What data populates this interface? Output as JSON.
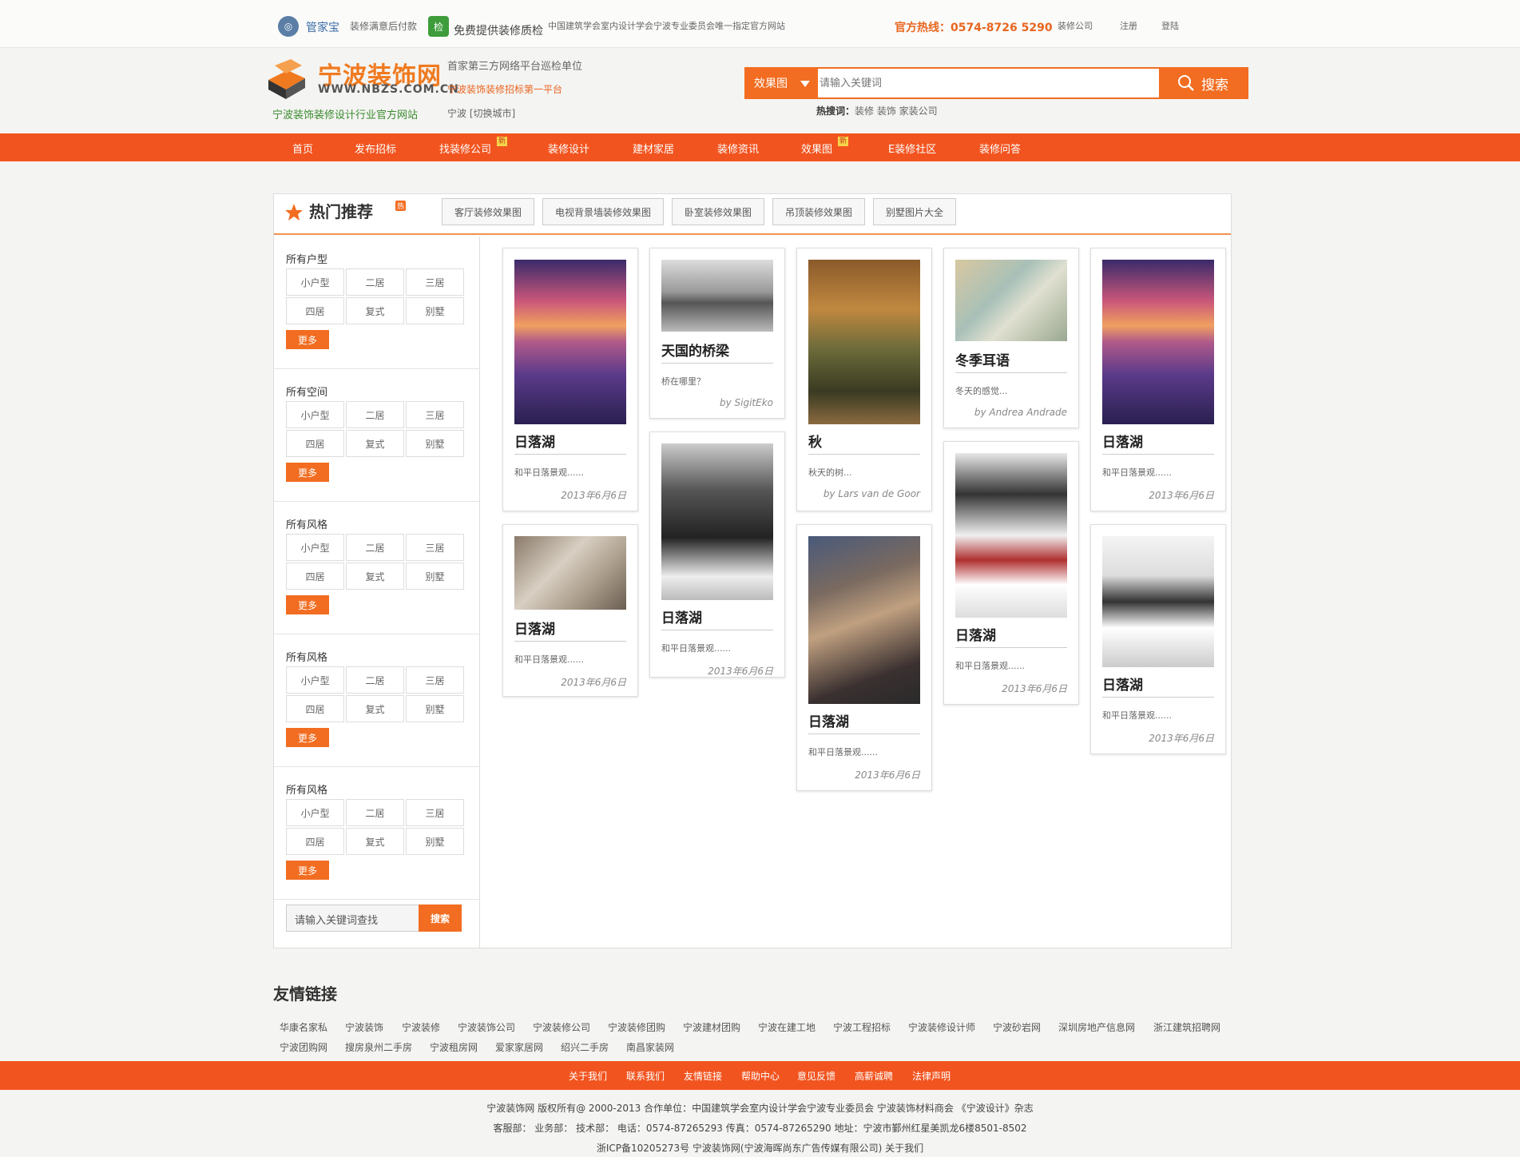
{
  "topbar": {
    "guanjiabao": "管家宝",
    "pay_after": "装修满意后付款",
    "check_badge": "检",
    "free_check": "免费提供装修质检",
    "assoc": "中国建筑学会室内设计学会宁波专业委员会唯一指定官方网站",
    "hotline": "官方热线：0574-8726 5290",
    "company": "装修公司",
    "register": "注册",
    "login": "登陆"
  },
  "header": {
    "logo_text": "宁波装饰网",
    "logo_url": "WWW.NBZS.COM.CN",
    "slogan": "宁波装饰装修设计行业官方网站",
    "line1": "首家第三方网络平台巡检单位",
    "line2": "宁波装饰装修招标第一平台",
    "city": "宁波  [切换城市]"
  },
  "search": {
    "select": "效果图",
    "placeholder": "请输入关键词",
    "button": "搜索",
    "hot_label": "热搜词：",
    "hot_words": "装修  装饰  家装公司"
  },
  "nav": [
    {
      "label": "首页"
    },
    {
      "label": "发布招标"
    },
    {
      "label": "找装修公司",
      "badge": "新"
    },
    {
      "label": "装修设计"
    },
    {
      "label": "建材家居"
    },
    {
      "label": "装修资讯"
    },
    {
      "label": "效果图",
      "badge": "新"
    },
    {
      "label": "E装修社区"
    },
    {
      "label": "装修问答"
    }
  ],
  "hot": {
    "title": "热门推荐",
    "badge": "热",
    "tabs": [
      "客厅装修效果图",
      "电视背景墙装修效果图",
      "卧室装修效果图",
      "吊顶装修效果图",
      "别墅图片大全"
    ]
  },
  "filters": [
    {
      "title": "所有户型",
      "options": [
        "小户型",
        "二居",
        "三居",
        "四居",
        "复式",
        "别墅"
      ],
      "more": "更多"
    },
    {
      "title": "所有空间",
      "options": [
        "小户型",
        "二居",
        "三居",
        "四居",
        "复式",
        "别墅"
      ],
      "more": "更多"
    },
    {
      "title": "所有风格",
      "options": [
        "小户型",
        "二居",
        "三居",
        "四居",
        "复式",
        "别墅"
      ],
      "more": "更多"
    },
    {
      "title": "所有风格",
      "options": [
        "小户型",
        "二居",
        "三居",
        "四居",
        "复式",
        "别墅"
      ],
      "more": "更多"
    },
    {
      "title": "所有风格",
      "options": [
        "小户型",
        "二居",
        "三居",
        "四居",
        "复式",
        "别墅"
      ],
      "more": "更多"
    }
  ],
  "side_search": {
    "placeholder": "请输入关键词查找",
    "button": "搜索"
  },
  "cards": [
    {
      "title": "日落湖",
      "desc": "和平日落景观......",
      "date": "2013年6月6日"
    },
    {
      "title": "日落湖",
      "desc": "和平日落景观......",
      "date": "2013年6月6日"
    },
    {
      "title": "天国的桥梁",
      "desc": "桥在哪里？",
      "date": "by SigitEko"
    },
    {
      "title": "日落湖",
      "desc": "和平日落景观......",
      "date": "2013年6月6日"
    },
    {
      "title": "秋",
      "desc": "秋天的树...",
      "date": "by Lars van de Goor"
    },
    {
      "title": "日落湖",
      "desc": "和平日落景观......",
      "date": "2013年6月6日"
    },
    {
      "title": "冬季耳语",
      "desc": "冬天的感觉...",
      "date": "by Andrea Andrade"
    },
    {
      "title": "日落湖",
      "desc": "和平日落景观......",
      "date": "2013年6月6日"
    },
    {
      "title": "日落湖",
      "desc": "和平日落景观......",
      "date": "2013年6月6日"
    },
    {
      "title": "日落湖",
      "desc": "和平日落景观......",
      "date": "2013年6月6日"
    }
  ],
  "links": {
    "title": "友情链接",
    "items": [
      "华康名家私",
      "宁波装饰",
      "宁波装修",
      "宁波装饰公司",
      "宁波装修公司",
      "宁波装修团购",
      "宁波建材团购",
      "宁波在建工地",
      "宁波工程招标",
      "宁波装修设计师",
      "宁波砂岩网",
      "深圳房地产信息网",
      "浙江建筑招聘网",
      "宁波团购网",
      "搜房泉州二手房",
      "宁波租房网",
      "爱家家居网",
      "绍兴二手房",
      "南昌家装网"
    ]
  },
  "footer": {
    "nav": [
      "关于我们",
      "联系我们",
      "友情链接",
      "帮助中心",
      "意见反馈",
      "高薪诚聘",
      "法律声明"
    ],
    "line1": "宁波装饰网 版权所有@ 2000-2013    合作单位：中国建筑学会室内设计学会宁波专业委员会 宁波装饰材料商会 《宁波设计》杂志",
    "line2": "客服部：   业务部：   技术部：   电话：0574-87265293   传真：0574-87265290   地址：宁波市鄞州红星美凯龙6楼8501-8502",
    "line3": "浙ICP备10205273号 宁波装饰网(宁波海晖尚东广告传媒有限公司) 关于我们"
  },
  "colors": {
    "accent": "#f26d21",
    "nav": "#f2541f",
    "logo": "#f07a1f",
    "slogan": "#3a8a2e"
  }
}
